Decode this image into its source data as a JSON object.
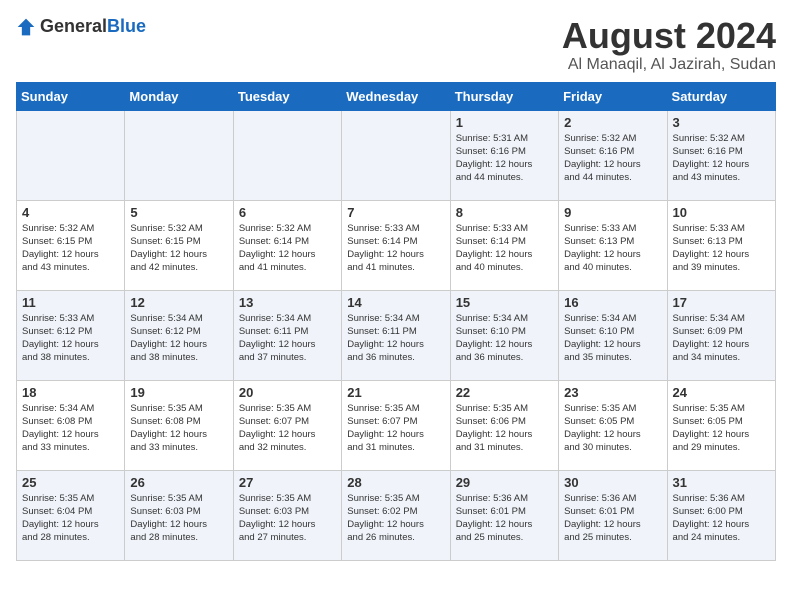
{
  "header": {
    "logo_general": "General",
    "logo_blue": "Blue",
    "title": "August 2024",
    "subtitle": "Al Manaqil, Al Jazirah, Sudan"
  },
  "weekdays": [
    "Sunday",
    "Monday",
    "Tuesday",
    "Wednesday",
    "Thursday",
    "Friday",
    "Saturday"
  ],
  "weeks": [
    [
      {
        "day": "",
        "info": ""
      },
      {
        "day": "",
        "info": ""
      },
      {
        "day": "",
        "info": ""
      },
      {
        "day": "",
        "info": ""
      },
      {
        "day": "1",
        "info": "Sunrise: 5:31 AM\nSunset: 6:16 PM\nDaylight: 12 hours\nand 44 minutes."
      },
      {
        "day": "2",
        "info": "Sunrise: 5:32 AM\nSunset: 6:16 PM\nDaylight: 12 hours\nand 44 minutes."
      },
      {
        "day": "3",
        "info": "Sunrise: 5:32 AM\nSunset: 6:16 PM\nDaylight: 12 hours\nand 43 minutes."
      }
    ],
    [
      {
        "day": "4",
        "info": "Sunrise: 5:32 AM\nSunset: 6:15 PM\nDaylight: 12 hours\nand 43 minutes."
      },
      {
        "day": "5",
        "info": "Sunrise: 5:32 AM\nSunset: 6:15 PM\nDaylight: 12 hours\nand 42 minutes."
      },
      {
        "day": "6",
        "info": "Sunrise: 5:32 AM\nSunset: 6:14 PM\nDaylight: 12 hours\nand 41 minutes."
      },
      {
        "day": "7",
        "info": "Sunrise: 5:33 AM\nSunset: 6:14 PM\nDaylight: 12 hours\nand 41 minutes."
      },
      {
        "day": "8",
        "info": "Sunrise: 5:33 AM\nSunset: 6:14 PM\nDaylight: 12 hours\nand 40 minutes."
      },
      {
        "day": "9",
        "info": "Sunrise: 5:33 AM\nSunset: 6:13 PM\nDaylight: 12 hours\nand 40 minutes."
      },
      {
        "day": "10",
        "info": "Sunrise: 5:33 AM\nSunset: 6:13 PM\nDaylight: 12 hours\nand 39 minutes."
      }
    ],
    [
      {
        "day": "11",
        "info": "Sunrise: 5:33 AM\nSunset: 6:12 PM\nDaylight: 12 hours\nand 38 minutes."
      },
      {
        "day": "12",
        "info": "Sunrise: 5:34 AM\nSunset: 6:12 PM\nDaylight: 12 hours\nand 38 minutes."
      },
      {
        "day": "13",
        "info": "Sunrise: 5:34 AM\nSunset: 6:11 PM\nDaylight: 12 hours\nand 37 minutes."
      },
      {
        "day": "14",
        "info": "Sunrise: 5:34 AM\nSunset: 6:11 PM\nDaylight: 12 hours\nand 36 minutes."
      },
      {
        "day": "15",
        "info": "Sunrise: 5:34 AM\nSunset: 6:10 PM\nDaylight: 12 hours\nand 36 minutes."
      },
      {
        "day": "16",
        "info": "Sunrise: 5:34 AM\nSunset: 6:10 PM\nDaylight: 12 hours\nand 35 minutes."
      },
      {
        "day": "17",
        "info": "Sunrise: 5:34 AM\nSunset: 6:09 PM\nDaylight: 12 hours\nand 34 minutes."
      }
    ],
    [
      {
        "day": "18",
        "info": "Sunrise: 5:34 AM\nSunset: 6:08 PM\nDaylight: 12 hours\nand 33 minutes."
      },
      {
        "day": "19",
        "info": "Sunrise: 5:35 AM\nSunset: 6:08 PM\nDaylight: 12 hours\nand 33 minutes."
      },
      {
        "day": "20",
        "info": "Sunrise: 5:35 AM\nSunset: 6:07 PM\nDaylight: 12 hours\nand 32 minutes."
      },
      {
        "day": "21",
        "info": "Sunrise: 5:35 AM\nSunset: 6:07 PM\nDaylight: 12 hours\nand 31 minutes."
      },
      {
        "day": "22",
        "info": "Sunrise: 5:35 AM\nSunset: 6:06 PM\nDaylight: 12 hours\nand 31 minutes."
      },
      {
        "day": "23",
        "info": "Sunrise: 5:35 AM\nSunset: 6:05 PM\nDaylight: 12 hours\nand 30 minutes."
      },
      {
        "day": "24",
        "info": "Sunrise: 5:35 AM\nSunset: 6:05 PM\nDaylight: 12 hours\nand 29 minutes."
      }
    ],
    [
      {
        "day": "25",
        "info": "Sunrise: 5:35 AM\nSunset: 6:04 PM\nDaylight: 12 hours\nand 28 minutes."
      },
      {
        "day": "26",
        "info": "Sunrise: 5:35 AM\nSunset: 6:03 PM\nDaylight: 12 hours\nand 28 minutes."
      },
      {
        "day": "27",
        "info": "Sunrise: 5:35 AM\nSunset: 6:03 PM\nDaylight: 12 hours\nand 27 minutes."
      },
      {
        "day": "28",
        "info": "Sunrise: 5:35 AM\nSunset: 6:02 PM\nDaylight: 12 hours\nand 26 minutes."
      },
      {
        "day": "29",
        "info": "Sunrise: 5:36 AM\nSunset: 6:01 PM\nDaylight: 12 hours\nand 25 minutes."
      },
      {
        "day": "30",
        "info": "Sunrise: 5:36 AM\nSunset: 6:01 PM\nDaylight: 12 hours\nand 25 minutes."
      },
      {
        "day": "31",
        "info": "Sunrise: 5:36 AM\nSunset: 6:00 PM\nDaylight: 12 hours\nand 24 minutes."
      }
    ]
  ]
}
